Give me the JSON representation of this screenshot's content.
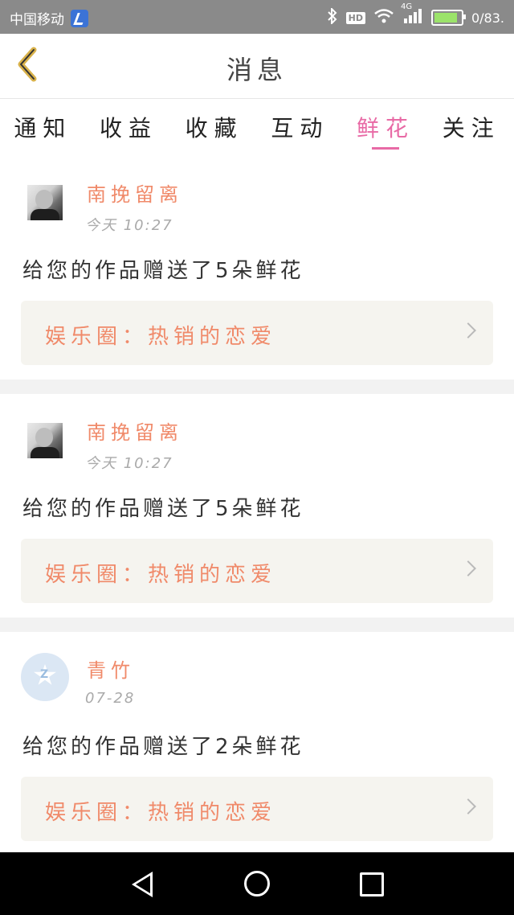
{
  "status_bar": {
    "carrier": "中国移动",
    "network": "4G",
    "hd": "HD",
    "battery_text": "0/83."
  },
  "header": {
    "title": "消息"
  },
  "tabs": [
    {
      "label": "通知",
      "active": false
    },
    {
      "label": "收益",
      "active": false
    },
    {
      "label": "收藏",
      "active": false
    },
    {
      "label": "互动",
      "active": false
    },
    {
      "label": "鲜花",
      "active": true
    },
    {
      "label": "关注",
      "active": false
    }
  ],
  "feed": [
    {
      "name": "南挽留离",
      "time": "今天 10:27",
      "message": "给您的作品赠送了5朵鲜花",
      "link": "娱乐圈：热销的恋爱",
      "avatar": "photo"
    },
    {
      "name": "南挽留离",
      "time": "今天 10:27",
      "message": "给您的作品赠送了5朵鲜花",
      "link": "娱乐圈：热销的恋爱",
      "avatar": "photo"
    },
    {
      "name": "青竹",
      "time": "07-28",
      "message": "给您的作品赠送了2朵鲜花",
      "link": "娱乐圈：热销的恋爱",
      "avatar": "qq-default"
    }
  ],
  "colors": {
    "accent": "#e86aa5",
    "name_color": "#f08a6a",
    "status_bar": "#8a8a8a",
    "link_bg": "#f5f4ef"
  }
}
